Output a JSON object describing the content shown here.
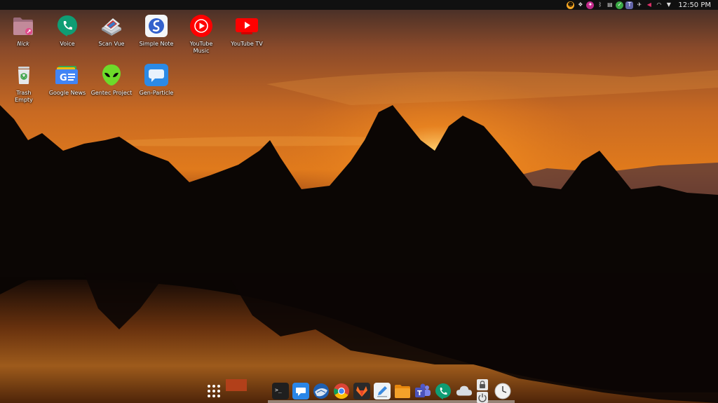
{
  "top_panel": {
    "clock": "12:50 PM",
    "tray_icons": [
      "emoji-icon",
      "dropbox-icon",
      "pinwheel-icon",
      "bluetooth-icon",
      "clipboard-icon",
      "check-icon",
      "teams-icon",
      "airplane-icon",
      "volume-icon",
      "wifi-icon",
      "menu-caret-icon"
    ]
  },
  "desktop": {
    "icons": [
      {
        "name": "desktop-icon-nick",
        "label": "Nick",
        "glyph": "folder-icon"
      },
      {
        "name": "desktop-icon-voice",
        "label": "Voice",
        "glyph": "phone-icon"
      },
      {
        "name": "desktop-icon-scan-vue",
        "label": "Scan Vue",
        "glyph": "scanner-icon"
      },
      {
        "name": "desktop-icon-simple-note",
        "label": "Simple Note",
        "glyph": "simplenote-icon"
      },
      {
        "name": "desktop-icon-youtube-music",
        "label": "YouTube Music",
        "glyph": "youtube-music-icon"
      },
      {
        "name": "desktop-icon-youtube-tv",
        "label": "YouTube TV",
        "glyph": "youtube-tv-icon"
      },
      {
        "name": "desktop-icon-trash",
        "label": "Trash Empty",
        "glyph": "trash-icon"
      },
      {
        "name": "desktop-icon-google-news",
        "label": "Google News",
        "glyph": "google-news-icon"
      },
      {
        "name": "desktop-icon-gentec-project",
        "label": "Gentec Project",
        "glyph": "alien-icon"
      },
      {
        "name": "desktop-icon-gen-particle",
        "label": "Gen-Particle",
        "glyph": "chat-icon"
      }
    ]
  },
  "dock": {
    "items": [
      "app-launcher-icon",
      "terminal-icon",
      "mail-icon",
      "thunderbird-icon",
      "chrome-icon",
      "gitlab-icon",
      "text-editor-icon",
      "files-icon",
      "teams-icon",
      "phone-icon",
      "cloud-icon",
      "lock-power-icon",
      "clock-icon"
    ]
  },
  "colors": {
    "panel": "#101010",
    "running_window": "#b2401a"
  }
}
